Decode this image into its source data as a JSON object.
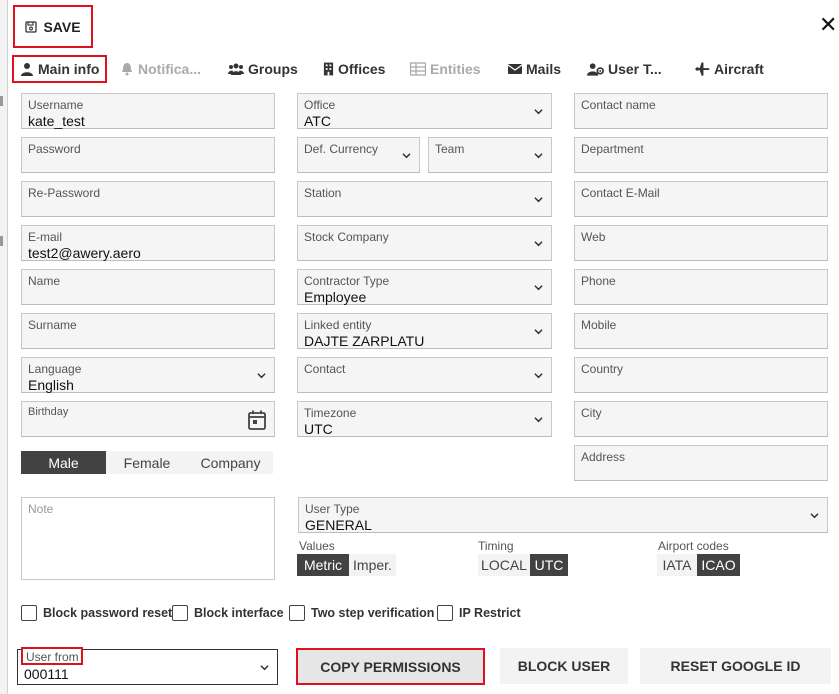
{
  "toolbar": {
    "save_label": "SAVE"
  },
  "tabs": [
    {
      "label": "Main info",
      "icon": "user-icon",
      "active": true
    },
    {
      "label": "Notifica...",
      "icon": "bell-icon",
      "disabled": true
    },
    {
      "label": "Groups",
      "icon": "users-icon"
    },
    {
      "label": "Offices",
      "icon": "building-icon"
    },
    {
      "label": "Entities",
      "icon": "table-icon",
      "disabled": true
    },
    {
      "label": "Mails",
      "icon": "envelope-icon"
    },
    {
      "label": "User T...",
      "icon": "users-cog-icon"
    },
    {
      "label": "Aircraft",
      "icon": "plane-icon"
    }
  ],
  "left_col": {
    "username": {
      "label": "Username",
      "value": "kate_test"
    },
    "password": {
      "label": "Password",
      "value": ""
    },
    "repassword": {
      "label": "Re-Password",
      "value": ""
    },
    "email": {
      "label": "E-mail",
      "value": "test2@awery.aero"
    },
    "name": {
      "label": "Name",
      "value": ""
    },
    "surname": {
      "label": "Surname",
      "value": ""
    },
    "language": {
      "label": "Language",
      "value": "English"
    },
    "birthday": {
      "label": "Birthday",
      "value": ""
    },
    "gender": [
      "Male",
      "Female",
      "Company"
    ],
    "note": {
      "label": "Note",
      "value": ""
    }
  },
  "mid_col": {
    "office": {
      "label": "Office",
      "value": "ATC"
    },
    "currency": {
      "label": "Def. Currency",
      "value": ""
    },
    "team": {
      "label": "Team",
      "value": ""
    },
    "station": {
      "label": "Station",
      "value": ""
    },
    "stock": {
      "label": "Stock Company",
      "value": ""
    },
    "contractor": {
      "label": "Contractor Type",
      "value": "Employee"
    },
    "linked": {
      "label": "Linked entity",
      "value": "DAJTE ZARPLATU"
    },
    "contact": {
      "label": "Contact",
      "value": ""
    },
    "timezone": {
      "label": "Timezone",
      "value": "UTC"
    }
  },
  "right_col": {
    "contact_name": {
      "label": "Contact name"
    },
    "department": {
      "label": "Department"
    },
    "contact_email": {
      "label": "Contact E-Mail"
    },
    "web": {
      "label": "Web"
    },
    "phone": {
      "label": "Phone"
    },
    "mobile": {
      "label": "Mobile"
    },
    "country": {
      "label": "Country"
    },
    "city": {
      "label": "City"
    },
    "address": {
      "label": "Address"
    }
  },
  "user_type": {
    "label": "User Type",
    "value": "GENERAL"
  },
  "values": {
    "label": "Values",
    "options": [
      "Metric",
      "Imper."
    ]
  },
  "timing": {
    "label": "Timing",
    "options": [
      "LOCAL",
      "UTC"
    ]
  },
  "airport_codes": {
    "label": "Airport codes",
    "options": [
      "IATA",
      "ICAO"
    ]
  },
  "checkboxes": [
    "Block password reset",
    "Block interface",
    "Two step verification",
    "IP Restrict"
  ],
  "user_from": {
    "label": "User from",
    "value": "000111"
  },
  "buttons": {
    "copy": "COPY PERMISSIONS",
    "block": "BLOCK USER",
    "reset": "RESET GOOGLE ID"
  },
  "colors": {
    "accent_red": "#e0101e",
    "segment_active": "#424242",
    "field_bg": "#f5f5f5"
  }
}
